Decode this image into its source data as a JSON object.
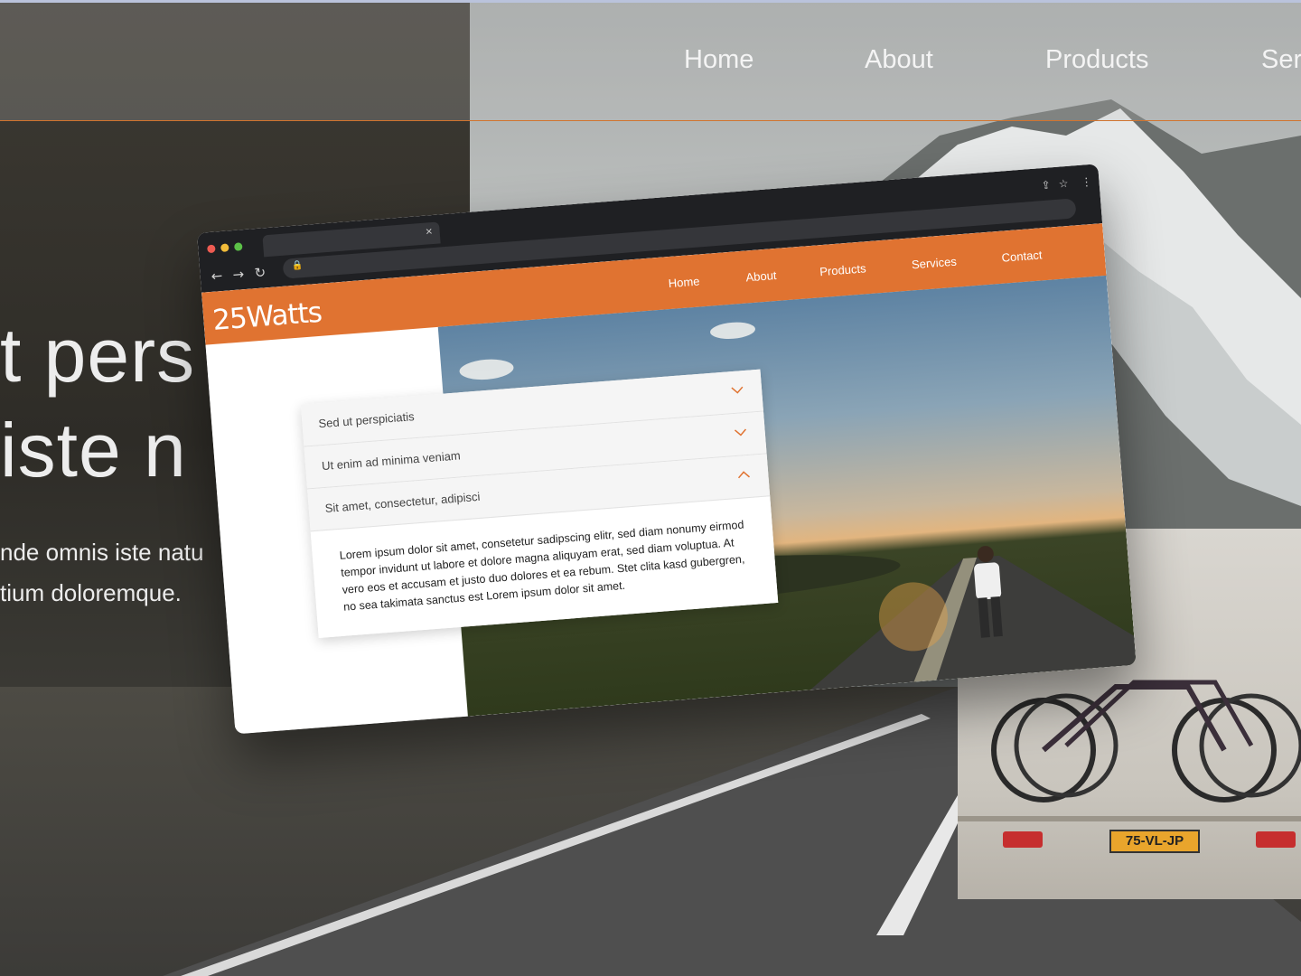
{
  "background_site": {
    "nav": [
      "Home",
      "About",
      "Products",
      "Ser"
    ],
    "hero_lines": [
      "t pers",
      "iste n"
    ],
    "hero_paragraph": [
      "nde omnis iste natu",
      "tium doloremque."
    ],
    "plate": "75-VL-JP",
    "accent": "#d0742f"
  },
  "browser": {
    "tab_close": "×",
    "nav_icons": [
      "back-icon",
      "forward-icon",
      "reload-icon"
    ]
  },
  "site": {
    "logo": "25Watts",
    "brand_color": "#e07331",
    "nav": [
      "Home",
      "About",
      "Products",
      "Services",
      "Contact"
    ],
    "accordion": [
      {
        "title": "Sed ut perspiciatis",
        "expanded": false
      },
      {
        "title": "Ut enim ad minima veniam",
        "expanded": false
      },
      {
        "title": "Sit amet, consectetur, adipisci",
        "expanded": true
      }
    ],
    "accordion_body": "Lorem ipsum dolor sit amet, consetetur sadipscing elitr, sed diam nonumy eirmod tempor invidunt ut labore et dolore magna aliquyam erat, sed diam voluptua. At vero eos et accusam et justo duo dolores et ea rebum. Stet clita kasd gubergren, no sea takimata sanctus est Lorem ipsum dolor sit amet."
  }
}
